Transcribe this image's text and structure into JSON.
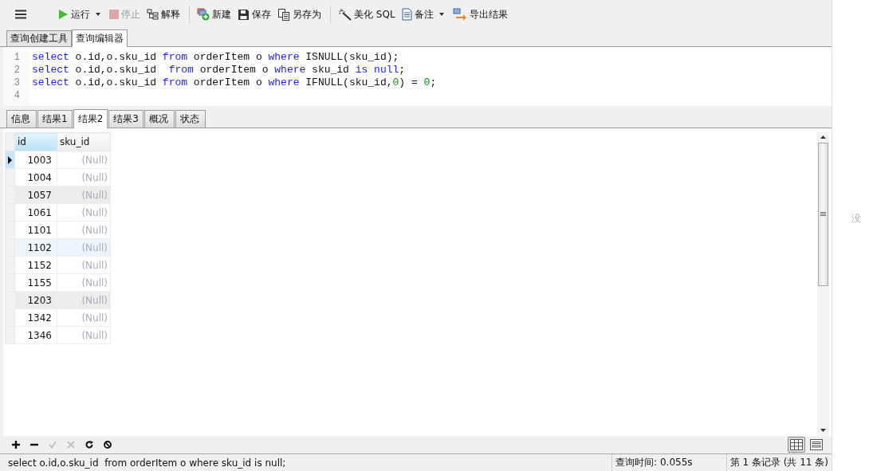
{
  "toolbar": {
    "groups": [
      [
        {
          "kind": "run",
          "label": "运行",
          "dropdown": true,
          "disabled": false
        },
        {
          "kind": "stop",
          "label": "停止",
          "dropdown": false,
          "disabled": true
        },
        {
          "kind": "explain",
          "label": "解释",
          "dropdown": false,
          "disabled": false
        }
      ],
      [
        {
          "kind": "new",
          "label": "新建",
          "dropdown": false,
          "disabled": false
        },
        {
          "kind": "save",
          "label": "保存",
          "dropdown": false,
          "disabled": false
        },
        {
          "kind": "saveas",
          "label": "另存为",
          "dropdown": false,
          "disabled": false
        }
      ],
      [
        {
          "kind": "beautify",
          "label": "美化 SQL",
          "dropdown": false,
          "disabled": false
        },
        {
          "kind": "note",
          "label": "备注",
          "dropdown": true,
          "disabled": false
        },
        {
          "kind": "export",
          "label": "导出结果",
          "dropdown": false,
          "disabled": false
        }
      ]
    ]
  },
  "query_tabs": [
    {
      "label": "查询创建工具",
      "selected": false
    },
    {
      "label": "查询编辑器",
      "selected": true
    }
  ],
  "editor": {
    "lines": [
      {
        "number": "1",
        "tokens": [
          {
            "kind": "keyword",
            "text": "select"
          },
          {
            "kind": "plain",
            "text": " o.id,o.sku_id "
          },
          {
            "kind": "keyword",
            "text": "from"
          },
          {
            "kind": "plain",
            "text": " orderItem o "
          },
          {
            "kind": "keyword",
            "text": "where"
          },
          {
            "kind": "plain",
            "text": " ISNULL(sku_id);"
          }
        ]
      },
      {
        "number": "2",
        "tokens": [
          {
            "kind": "keyword",
            "text": "select"
          },
          {
            "kind": "plain",
            "text": " o.id,o.sku_id  "
          },
          {
            "kind": "keyword",
            "text": "from"
          },
          {
            "kind": "plain",
            "text": " orderItem o "
          },
          {
            "kind": "keyword",
            "text": "where"
          },
          {
            "kind": "plain",
            "text": " sku_id "
          },
          {
            "kind": "keyword",
            "text": "is null"
          },
          {
            "kind": "plain",
            "text": ";"
          }
        ]
      },
      {
        "number": "3",
        "tokens": [
          {
            "kind": "keyword",
            "text": "select"
          },
          {
            "kind": "plain",
            "text": " o.id,o.sku_id "
          },
          {
            "kind": "keyword",
            "text": "from"
          },
          {
            "kind": "plain",
            "text": " orderItem o "
          },
          {
            "kind": "keyword",
            "text": "where"
          },
          {
            "kind": "plain",
            "text": " IFNULL(sku_id,"
          },
          {
            "kind": "number",
            "text": "0"
          },
          {
            "kind": "plain",
            "text": ") = "
          },
          {
            "kind": "number",
            "text": "0"
          },
          {
            "kind": "plain",
            "text": ";"
          }
        ]
      },
      {
        "number": "4"
      }
    ]
  },
  "result_tabs": [
    {
      "label": "信息",
      "selected": false
    },
    {
      "label": "结果1",
      "selected": false
    },
    {
      "label": "结果2",
      "selected": true
    },
    {
      "label": "结果3",
      "selected": false
    },
    {
      "label": "概况",
      "selected": false
    },
    {
      "label": "状态",
      "selected": false
    }
  ],
  "table": {
    "columns": [
      "id",
      "sku_id"
    ],
    "rows": [
      {
        "cells": [
          "1003",
          "(Null)"
        ],
        "selected": true,
        "shaded": false,
        "hovered": false
      },
      {
        "cells": [
          "1004",
          "(Null)"
        ],
        "selected": false,
        "shaded": false,
        "hovered": false
      },
      {
        "cells": [
          "1057",
          "(Null)"
        ],
        "selected": false,
        "shaded": true,
        "hovered": false
      },
      {
        "cells": [
          "1061",
          "(Null)"
        ],
        "selected": false,
        "shaded": false,
        "hovered": false
      },
      {
        "cells": [
          "1101",
          "(Null)"
        ],
        "selected": false,
        "shaded": false,
        "hovered": false
      },
      {
        "cells": [
          "1102",
          "(Null)"
        ],
        "selected": false,
        "shaded": false,
        "hovered": true
      },
      {
        "cells": [
          "1152",
          "(Null)"
        ],
        "selected": false,
        "shaded": false,
        "hovered": false
      },
      {
        "cells": [
          "1155",
          "(Null)"
        ],
        "selected": false,
        "shaded": false,
        "hovered": false
      },
      {
        "cells": [
          "1203",
          "(Null)"
        ],
        "selected": false,
        "shaded": true,
        "hovered": false
      },
      {
        "cells": [
          "1342",
          "(Null)"
        ],
        "selected": false,
        "shaded": false,
        "hovered": false
      },
      {
        "cells": [
          "1346",
          "(Null)"
        ],
        "selected": false,
        "shaded": false,
        "hovered": false
      }
    ]
  },
  "grid_toolbar": {
    "buttons": [
      {
        "kind": "add",
        "disabled": false
      },
      {
        "kind": "delete",
        "disabled": false
      },
      {
        "kind": "apply",
        "disabled": true
      },
      {
        "kind": "discard",
        "disabled": true
      },
      {
        "kind": "refresh",
        "disabled": false
      },
      {
        "kind": "stop",
        "disabled": false
      }
    ],
    "views": [
      {
        "kind": "grid",
        "selected": true
      },
      {
        "kind": "form",
        "selected": false
      }
    ]
  },
  "status_bar": {
    "sql": "select o.id,o.sku_id  from orderItem o where sku_id is null;",
    "query_time": "查询时间: 0.055s",
    "records": "第 1 条记录 (共 11 条)"
  },
  "side_panel": {
    "text": "没"
  }
}
